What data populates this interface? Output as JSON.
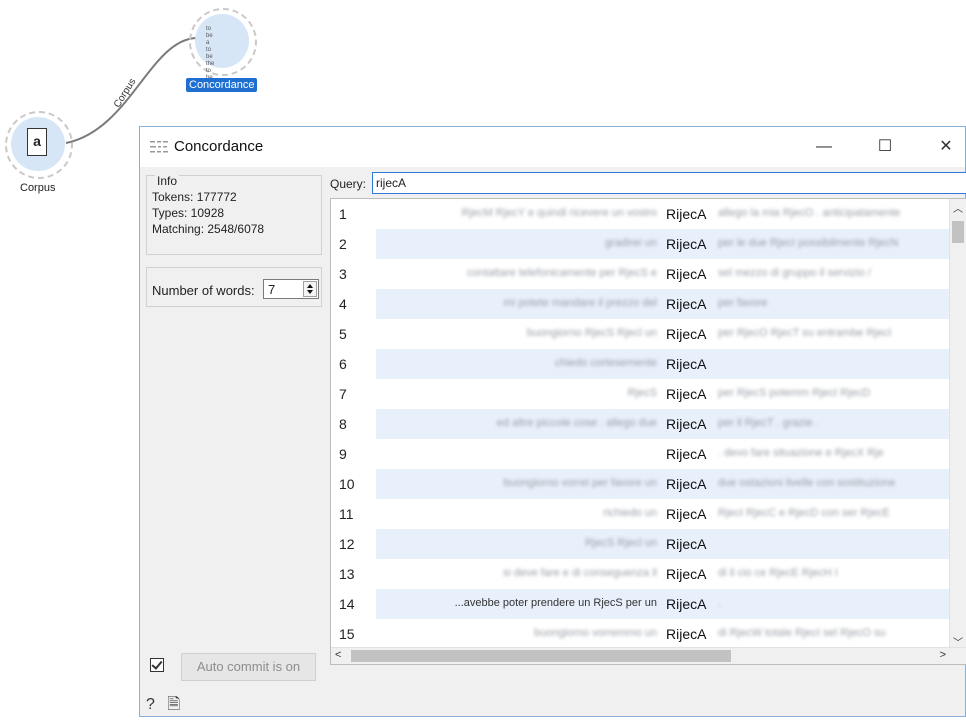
{
  "canvas": {
    "link_label": "Corpus",
    "corpus_node": {
      "label": "Corpus",
      "icon_text": "a"
    },
    "concordance_node": {
      "label": "Concordance",
      "icon_lines": [
        "to be a",
        "to be the",
        "to be or"
      ]
    }
  },
  "window": {
    "title": "Concordance",
    "minimize_glyph": "—",
    "maximize_glyph": "☐",
    "close_glyph": "✕"
  },
  "info": {
    "title": "Info",
    "tokens": "Tokens: 177772",
    "types": "Types: 10928",
    "matching": "Matching: 2548/6078"
  },
  "options": {
    "number_of_words_label": "Number of words:",
    "number_of_words_value": "7"
  },
  "query": {
    "label": "Query:",
    "value": "rijecA"
  },
  "rows": [
    {
      "num": "1",
      "left": "RjecM RjecY e quindi ricevere un vostro",
      "word": "RijecA",
      "right": "allego la mia RjecO . anticipatamente"
    },
    {
      "num": "2",
      "left": "gradirei un",
      "word": "RijecA",
      "right": "per le due RjecI possibilmente RjecN"
    },
    {
      "num": "3",
      "left": "contattare telefonicamente per RjecS e",
      "word": "RijecA",
      "right": "sel mezzo di gruppo il servizio / "
    },
    {
      "num": "4",
      "left": "mi potete mandare il prezzo del",
      "word": "RijecA",
      "right": "per favore"
    },
    {
      "num": "5",
      "left": "buongiorno RjecS Rjecl un",
      "word": "RijecA",
      "right": "per RjecO RjecT su entrambe RjecI"
    },
    {
      "num": "6",
      "left": "chiedo cortesemente",
      "word": "RijecA",
      "right": ""
    },
    {
      "num": "7",
      "left": "RjecS",
      "word": "RijecA",
      "right": "per RjecS potemm RjecI RjecD"
    },
    {
      "num": "8",
      "left": "ed altre piccole cose . allego due",
      "word": "RijecA",
      "right": "per il RjecT . grazie ."
    },
    {
      "num": "9",
      "left": "",
      "word": "RijecA",
      "right": ". devo fare situazione e RjecX Rje"
    },
    {
      "num": "10",
      "left": "buongiorno vorrei per favore un",
      "word": "RijecA",
      "right": "due ostazioni livelle con sostituzione"
    },
    {
      "num": "11",
      "left": "richiedo un",
      "word": "RijecA",
      "right": "RjecI RjecC e RjecD con ser RjecE"
    },
    {
      "num": "12",
      "left": "RjecS Rjecl un",
      "word": "RijecA",
      "right": ""
    },
    {
      "num": "13",
      "left": "si deve fare e di conseguenza il",
      "word": "RijecA",
      "right": "di il cio ce RjecE RjecH I"
    },
    {
      "num": "14",
      "left": "...avebbe poter prendere un RjecS per un",
      "word": "RijecA",
      "right": "."
    },
    {
      "num": "15",
      "left": "buongiorno vorremmo un",
      "word": "RijecA",
      "right": "di RjecW totale RjecI sel RjecO su"
    }
  ],
  "footer": {
    "auto_commit_label": "Auto commit is on",
    "help_glyph": "?",
    "report_glyph": "🗎"
  }
}
